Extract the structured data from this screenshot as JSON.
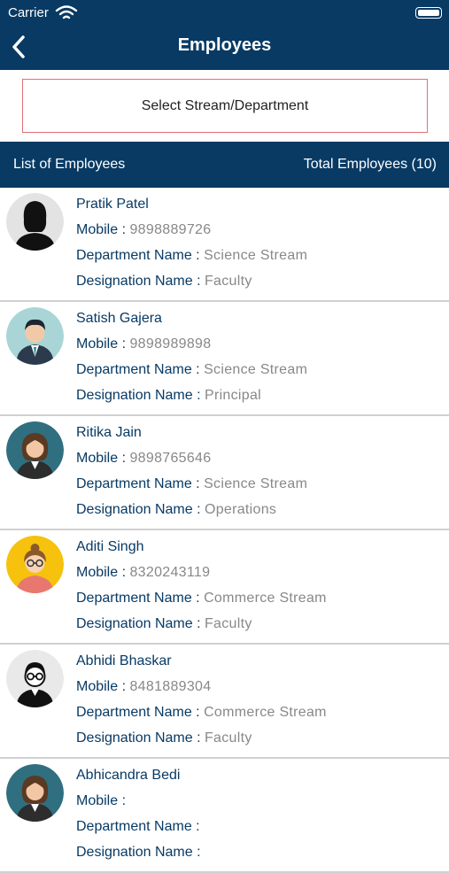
{
  "status": {
    "carrier": "Carrier"
  },
  "header": {
    "title": "Employees"
  },
  "filter": {
    "select_label": "Select Stream/Department"
  },
  "list_header": {
    "left": "List of Employees",
    "right": "Total Employees (10)"
  },
  "labels": {
    "mobile": "Mobile : ",
    "department": "Department Name : ",
    "designation": "Designation Name :  "
  },
  "employees": [
    {
      "name": "Pratik Patel",
      "mobile": "9898889726",
      "department": "Science Stream",
      "designation": "Faculty",
      "avatar": "female-silhouette-icon"
    },
    {
      "name": "Satish Gajera",
      "mobile": "9898989898",
      "department": "Science Stream",
      "designation": "Principal",
      "avatar": "male-suit-icon"
    },
    {
      "name": "Ritika Jain",
      "mobile": "9898765646",
      "department": "Science Stream",
      "designation": "Operations",
      "avatar": "female-business-icon"
    },
    {
      "name": "Aditi Singh",
      "mobile": "8320243119",
      "department": "Commerce  Stream",
      "designation": "Faculty",
      "avatar": "female-glasses-icon"
    },
    {
      "name": "Abhidi Bhaskar",
      "mobile": "8481889304",
      "department": "Commerce  Stream",
      "designation": "Faculty",
      "avatar": "male-glasses-icon"
    },
    {
      "name": "Abhicandra Bedi",
      "mobile": "",
      "department": "",
      "designation": "",
      "avatar": "female-business-icon"
    }
  ],
  "colors": {
    "header_bg": "#083a64",
    "label": "#083a64",
    "value": "#888888",
    "select_border": "#e0707a"
  }
}
